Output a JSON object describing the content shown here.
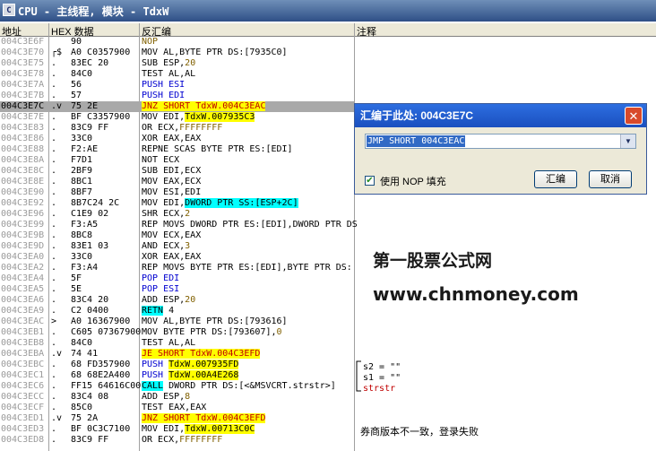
{
  "window": {
    "icon": "C",
    "title": "CPU - 主线程, 模块 - TdxW"
  },
  "headers": {
    "address": "地址",
    "hex": "HEX 数据",
    "disasm": "反汇编",
    "comment": "注释"
  },
  "rows": [
    {
      "addr": "004C3E6F",
      "mk": "",
      "hex": "90",
      "parts": [
        {
          "t": "NOP",
          "c": "brown"
        }
      ]
    },
    {
      "addr": "004C3E70",
      "mk": "┌$",
      "hex": "A0 C0357900",
      "parts": [
        {
          "t": "MOV AL,BYTE PTR DS:[7935C0]"
        }
      ]
    },
    {
      "addr": "004C3E75",
      "mk": ".",
      "hex": "83EC 20",
      "parts": [
        {
          "t": "SUB ESP,"
        },
        {
          "t": "20",
          "c": "brown"
        }
      ]
    },
    {
      "addr": "004C3E78",
      "mk": ".",
      "hex": "84C0",
      "parts": [
        {
          "t": "TEST AL,AL"
        }
      ]
    },
    {
      "addr": "004C3E7A",
      "mk": ".",
      "hex": "56",
      "parts": [
        {
          "t": "PUSH ESI",
          "c": "blue"
        }
      ]
    },
    {
      "addr": "004C3E7B",
      "mk": ".",
      "hex": "57",
      "parts": [
        {
          "t": "PUSH EDI",
          "c": "blue"
        }
      ]
    },
    {
      "addr": "004C3E7C",
      "mk": ".v",
      "hex": "75 2E",
      "sel": true,
      "parts": [
        {
          "t": "JNZ SHORT TdxW.004C3EAC",
          "c": "red",
          "hl": "y"
        }
      ]
    },
    {
      "addr": "004C3E7E",
      "mk": ".",
      "hex": "BF C3357900",
      "parts": [
        {
          "t": "MOV EDI,"
        },
        {
          "t": "TdxW.007935C3",
          "hl": "y"
        }
      ]
    },
    {
      "addr": "004C3E83",
      "mk": ".",
      "hex": "83C9 FF",
      "parts": [
        {
          "t": "OR ECX,"
        },
        {
          "t": "FFFFFFFF",
          "c": "brown"
        }
      ]
    },
    {
      "addr": "004C3E86",
      "mk": ".",
      "hex": "33C0",
      "parts": [
        {
          "t": "XOR EAX,EAX"
        }
      ]
    },
    {
      "addr": "004C3E88",
      "mk": ".",
      "hex": "F2:AE",
      "parts": [
        {
          "t": "REPNE SCAS BYTE PTR ES:[EDI]"
        }
      ]
    },
    {
      "addr": "004C3E8A",
      "mk": ".",
      "hex": "F7D1",
      "parts": [
        {
          "t": "NOT ECX"
        }
      ]
    },
    {
      "addr": "004C3E8C",
      "mk": ".",
      "hex": "2BF9",
      "parts": [
        {
          "t": "SUB EDI,ECX"
        }
      ]
    },
    {
      "addr": "004C3E8E",
      "mk": ".",
      "hex": "8BC1",
      "parts": [
        {
          "t": "MOV EAX,ECX"
        }
      ]
    },
    {
      "addr": "004C3E90",
      "mk": ".",
      "hex": "8BF7",
      "parts": [
        {
          "t": "MOV ESI,EDI"
        }
      ]
    },
    {
      "addr": "004C3E92",
      "mk": ".",
      "hex": "8B7C24 2C",
      "parts": [
        {
          "t": "MOV EDI,"
        },
        {
          "t": "DWORD PTR SS:[ESP+2C]",
          "hl": "c"
        }
      ]
    },
    {
      "addr": "004C3E96",
      "mk": ".",
      "hex": "C1E9 02",
      "parts": [
        {
          "t": "SHR ECX,"
        },
        {
          "t": "2",
          "c": "brown"
        }
      ]
    },
    {
      "addr": "004C3E99",
      "mk": ".",
      "hex": "F3:A5",
      "parts": [
        {
          "t": "REP MOVS DWORD PTR ES:[EDI],DWORD PTR DS"
        }
      ]
    },
    {
      "addr": "004C3E9B",
      "mk": ".",
      "hex": "8BC8",
      "parts": [
        {
          "t": "MOV ECX,EAX"
        }
      ]
    },
    {
      "addr": "004C3E9D",
      "mk": ".",
      "hex": "83E1 03",
      "parts": [
        {
          "t": "AND ECX,"
        },
        {
          "t": "3",
          "c": "brown"
        }
      ]
    },
    {
      "addr": "004C3EA0",
      "mk": ".",
      "hex": "33C0",
      "parts": [
        {
          "t": "XOR EAX,EAX"
        }
      ]
    },
    {
      "addr": "004C3EA2",
      "mk": ".",
      "hex": "F3:A4",
      "parts": [
        {
          "t": "REP MOVS BYTE PTR ES:[EDI],BYTE PTR DS:"
        }
      ]
    },
    {
      "addr": "004C3EA4",
      "mk": ".",
      "hex": "5F",
      "parts": [
        {
          "t": "POP EDI",
          "c": "blue"
        }
      ]
    },
    {
      "addr": "004C3EA5",
      "mk": ".",
      "hex": "5E",
      "parts": [
        {
          "t": "POP ESI",
          "c": "blue"
        }
      ]
    },
    {
      "addr": "004C3EA6",
      "mk": ".",
      "hex": "83C4 20",
      "parts": [
        {
          "t": "ADD ESP,"
        },
        {
          "t": "20",
          "c": "brown"
        }
      ]
    },
    {
      "addr": "004C3EA9",
      "mk": ".",
      "hex": "C2 0400",
      "parts": [
        {
          "t": "RETN",
          "hl": "c"
        },
        {
          "t": " 4"
        }
      ]
    },
    {
      "addr": "004C3EAC",
      "mk": ">",
      "hex": "A0 16367900",
      "parts": [
        {
          "t": "MOV AL,BYTE PTR DS:[793616]"
        }
      ]
    },
    {
      "addr": "004C3EB1",
      "mk": ".",
      "hex": "C605 07367900",
      "parts": [
        {
          "t": "MOV BYTE PTR DS:[793607],"
        },
        {
          "t": "0",
          "c": "brown"
        }
      ]
    },
    {
      "addr": "004C3EB8",
      "mk": ".",
      "hex": "84C0",
      "parts": [
        {
          "t": "TEST AL,AL"
        }
      ]
    },
    {
      "addr": "004C3EBA",
      "mk": ".v",
      "hex": "74 41",
      "parts": [
        {
          "t": "JE SHORT TdxW.004C3EFD",
          "c": "red",
          "hl": "y"
        }
      ]
    },
    {
      "addr": "004C3EBC",
      "mk": ".",
      "hex": "68 FD357900",
      "parts": [
        {
          "t": "PUSH ",
          "c": "blue"
        },
        {
          "t": "TdxW.007935FD",
          "hl": "y"
        }
      ]
    },
    {
      "addr": "004C3EC1",
      "mk": ".",
      "hex": "68 68E2A400",
      "parts": [
        {
          "t": "PUSH ",
          "c": "blue"
        },
        {
          "t": "TdxW.00A4E268",
          "hl": "y"
        }
      ]
    },
    {
      "addr": "004C3EC6",
      "mk": ".",
      "hex": "FF15 64616C00",
      "parts": [
        {
          "t": "CALL",
          "hl": "c"
        },
        {
          "t": " DWORD PTR DS:[<&MSVCRT.strstr>]"
        }
      ]
    },
    {
      "addr": "004C3ECC",
      "mk": ".",
      "hex": "83C4 08",
      "parts": [
        {
          "t": "ADD ESP,"
        },
        {
          "t": "8",
          "c": "brown"
        }
      ]
    },
    {
      "addr": "004C3ECF",
      "mk": ".",
      "hex": "85C0",
      "parts": [
        {
          "t": "TEST EAX,EAX"
        }
      ]
    },
    {
      "addr": "004C3ED1",
      "mk": ".v",
      "hex": "75 2A",
      "parts": [
        {
          "t": "JNZ SHORT TdxW.004C3EFD",
          "c": "red",
          "hl": "y"
        }
      ]
    },
    {
      "addr": "004C3ED3",
      "mk": ".",
      "hex": "BF 0C3C7100",
      "parts": [
        {
          "t": "MOV EDI,"
        },
        {
          "t": "TdxW.00713C0C",
          "hl": "y"
        }
      ]
    },
    {
      "addr": "004C3ED8",
      "mk": ".",
      "hex": "83C9 FF",
      "parts": [
        {
          "t": "OR ECX,"
        },
        {
          "t": "FFFFFFFF",
          "c": "brown"
        }
      ]
    }
  ],
  "comments": {
    "s2": "s2 = \"\"",
    "s1": "s1 = \"\"",
    "strstr": "strstr",
    "login_fail": "券商版本不一致，登录失败"
  },
  "dialog": {
    "title": "汇编于此处: 004C3E7C",
    "combo_value": "JMP SHORT 004C3EAC",
    "checkbox_label": "使用 NOP 填充",
    "checkbox_checked": true,
    "assemble_label": "汇编",
    "cancel_label": "取消"
  },
  "watermark": {
    "line1": "第一股票公式网",
    "line2": "www.chnmoney.com"
  }
}
